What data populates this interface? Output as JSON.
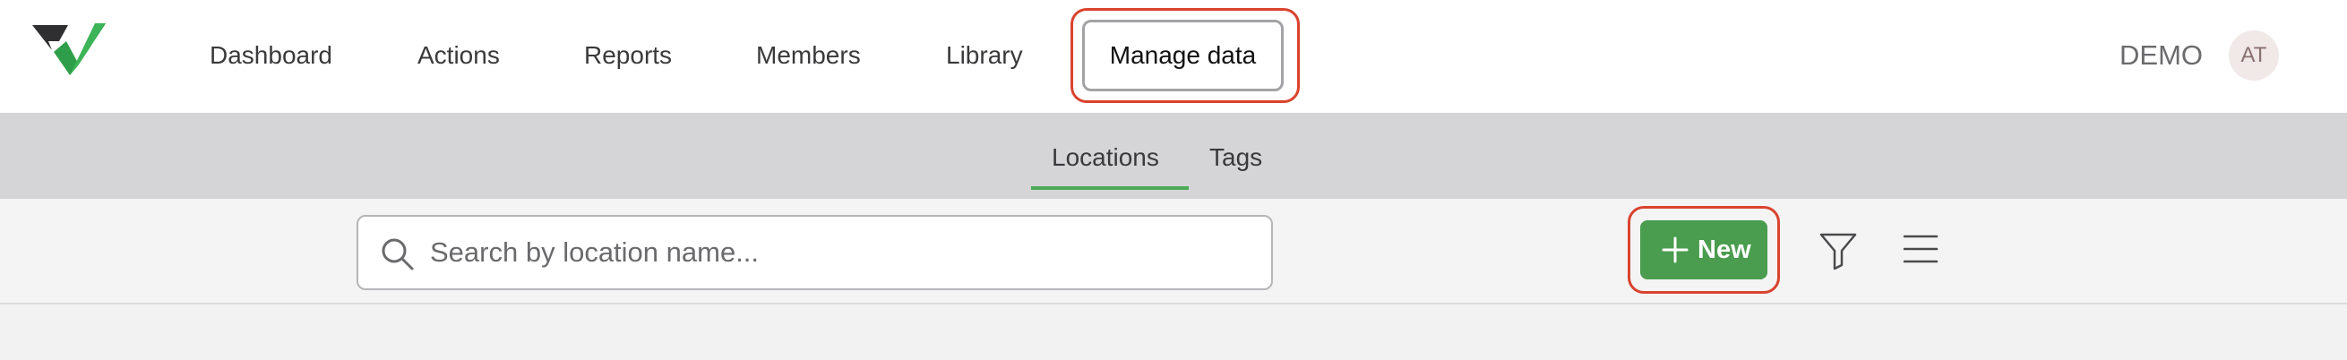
{
  "nav": {
    "items": [
      "Dashboard",
      "Actions",
      "Reports",
      "Members",
      "Library"
    ],
    "active_item": "Manage data",
    "workspace": "DEMO",
    "avatar_initials": "AT"
  },
  "subnav": {
    "tabs": [
      "Locations",
      "Tags"
    ],
    "active_tab": "Locations"
  },
  "toolbar": {
    "search_placeholder": "Search by location name...",
    "new_label": "New"
  },
  "colors": {
    "accent_green": "#4a9c4e",
    "highlight_red": "#d9432e",
    "subnav_bg": "#d5d5d8"
  },
  "icons": [
    "logo-icon",
    "search-icon",
    "plus-icon",
    "filter-icon",
    "menu-icon"
  ]
}
